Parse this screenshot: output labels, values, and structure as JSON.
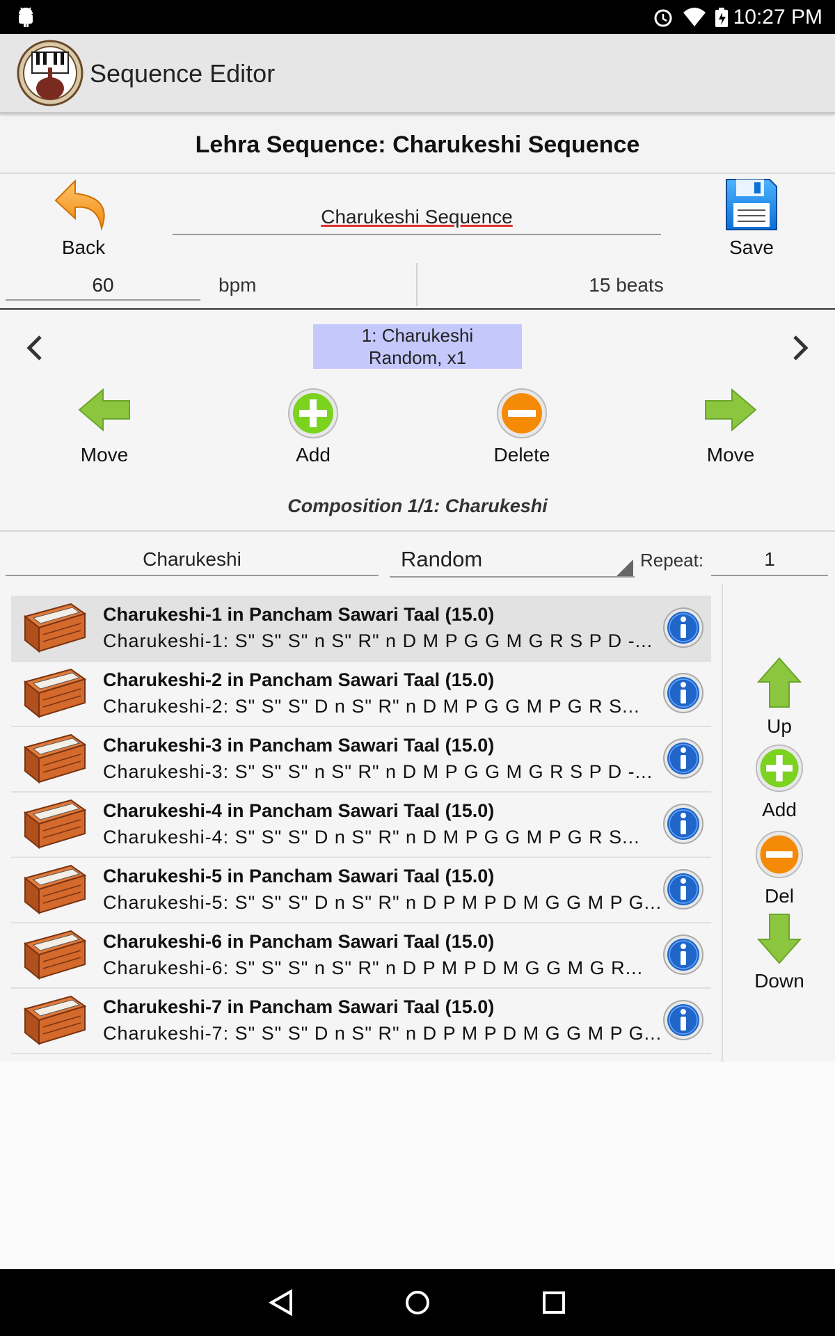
{
  "status_bar": {
    "time": "10:27 PM"
  },
  "app_bar": {
    "title": "Sequence Editor"
  },
  "heading": "Lehra Sequence: Charukeshi Sequence",
  "toolbar": {
    "back_label": "Back",
    "sequence_name": "Charukeshi Sequence",
    "save_label": "Save"
  },
  "tempo": {
    "bpm_value": "60",
    "bpm_unit": "bpm",
    "beats": "15 beats"
  },
  "sequence_item": {
    "line1": "1: Charukeshi",
    "line2": "Random, x1"
  },
  "actions": {
    "move_left": "Move",
    "add": "Add",
    "delete": "Delete",
    "move_right": "Move"
  },
  "composition_title": "Composition 1/1: Charukeshi",
  "composition": {
    "name": "Charukeshi",
    "mode": "Random",
    "repeat_label": "Repeat:",
    "repeat_value": "1"
  },
  "list": [
    {
      "title": "Charukeshi-1 in Pancham Sawari Taal (15.0)",
      "notes": "Charukeshi-1:  S\"  S\"  S\"  n S\" R\"  n  D  M  P  G  G M  G R  S  P D -..."
    },
    {
      "title": "Charukeshi-2 in Pancham Sawari Taal (15.0)",
      "notes": "Charukeshi-2:  S\"  S\"  S\"  D n S\" R\"  n  D  M  P  G  G M P  G R  S..."
    },
    {
      "title": "Charukeshi-3 in Pancham Sawari Taal (15.0)",
      "notes": "Charukeshi-3:  S\"  S\"  S\"  n S\" R\"  n  D  M  P  G  G M  G R  S  P D -..."
    },
    {
      "title": "Charukeshi-4 in Pancham Sawari Taal (15.0)",
      "notes": "Charukeshi-4:  S\"  S\"  S\"  D n S\" R\"  n  D  M  P  G  G M P  G R  S..."
    },
    {
      "title": "Charukeshi-5 in Pancham Sawari Taal (15.0)",
      "notes": "Charukeshi-5:  S\"  S\"  S\"  D n S\" R\"  n  D  P  M P D M  G  G M P  G..."
    },
    {
      "title": "Charukeshi-6 in Pancham Sawari Taal (15.0)",
      "notes": "Charukeshi-6:  S\"  S\"  S\"  n S\" R\"  n  D  P  M P D M  G  G M  G R..."
    },
    {
      "title": "Charukeshi-7 in Pancham Sawari Taal (15.0)",
      "notes": "Charukeshi-7:  S\"  S\"  S\"  D n S\" R\"  n  D  P  M P D M  G  G M P  G..."
    }
  ],
  "side_actions": {
    "up": "Up",
    "add": "Add",
    "del": "Del",
    "down": "Down"
  },
  "colors": {
    "accent_add": "#7bd21f",
    "accent_delete": "#f58a07",
    "arrow_green": "#8cc63f",
    "selection": "#c5c8fb"
  }
}
